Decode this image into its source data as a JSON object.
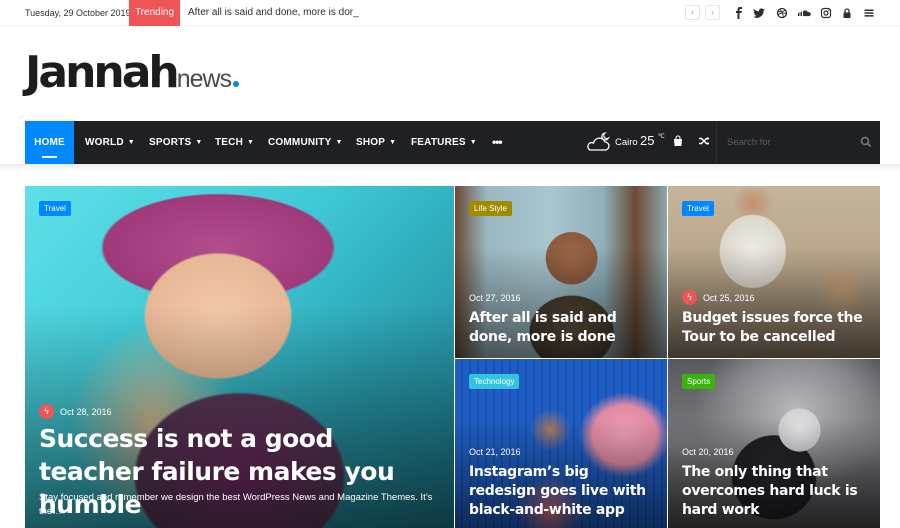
{
  "topbar": {
    "date": "Tuesday, 29 October 2019",
    "trending_label": "Trending",
    "trending_headline": "After all is said and done, more is dor_",
    "prev_label": "‹",
    "next_label": "›",
    "social_icons": [
      {
        "name": "facebook-icon",
        "glyph": "f"
      },
      {
        "name": "twitter-icon",
        "glyph": "t"
      },
      {
        "name": "dribbble-icon",
        "glyph": "⊛"
      },
      {
        "name": "soundcloud-icon",
        "glyph": "☁"
      },
      {
        "name": "instagram-icon",
        "glyph": "◎"
      },
      {
        "name": "lock-icon",
        "glyph": "🔒"
      },
      {
        "name": "menu-icon",
        "glyph": "≡"
      }
    ]
  },
  "logo": {
    "primary": "Jannah",
    "secondary": "news"
  },
  "nav": {
    "items": [
      {
        "label": "HOME",
        "active": true,
        "has_dropdown": false
      },
      {
        "label": "WORLD",
        "has_dropdown": true
      },
      {
        "label": "SPORTS",
        "has_dropdown": true
      },
      {
        "label": "TECH",
        "has_dropdown": true
      },
      {
        "label": "COMMUNITY",
        "has_dropdown": true
      },
      {
        "label": "SHOP",
        "has_dropdown": true
      },
      {
        "label": "FEATURES",
        "has_dropdown": true
      }
    ],
    "more_label": "•••",
    "caret": "▼",
    "weather": {
      "city": "Cairo",
      "temp": "25",
      "unit": "℃"
    },
    "search_placeholder": "Search for",
    "accent_color": "#0088ff"
  },
  "posts": [
    {
      "category": "Travel",
      "category_color": "#0088ff",
      "date": "Oct 28, 2016",
      "trending": true,
      "title": "Success is not a good teacher failure makes you humble",
      "excerpt": "Stay focused and remember we design the best WordPress News and Magazine Themes. It’s the…"
    },
    {
      "category": "Life Style",
      "category_color": "#a08a00",
      "date": "Oct 27, 2016",
      "trending": false,
      "title": "After all is said and done, more is done"
    },
    {
      "category": "Travel",
      "category_color": "#0088ff",
      "date": "Oct 25, 2016",
      "trending": true,
      "title": "Budget issues force the Tour to be cancelled"
    },
    {
      "category": "Technology",
      "category_color": "#32c3e0",
      "date": "Oct 21, 2016",
      "trending": false,
      "title": "Instagram’s big redesign goes live with black-and-white app"
    },
    {
      "category": "Sports",
      "category_color": "#3bb20e",
      "date": "Oct 20, 2016",
      "trending": false,
      "title": "The only thing that overcomes hard luck is hard work"
    }
  ],
  "bolt_glyph": "ϟ"
}
